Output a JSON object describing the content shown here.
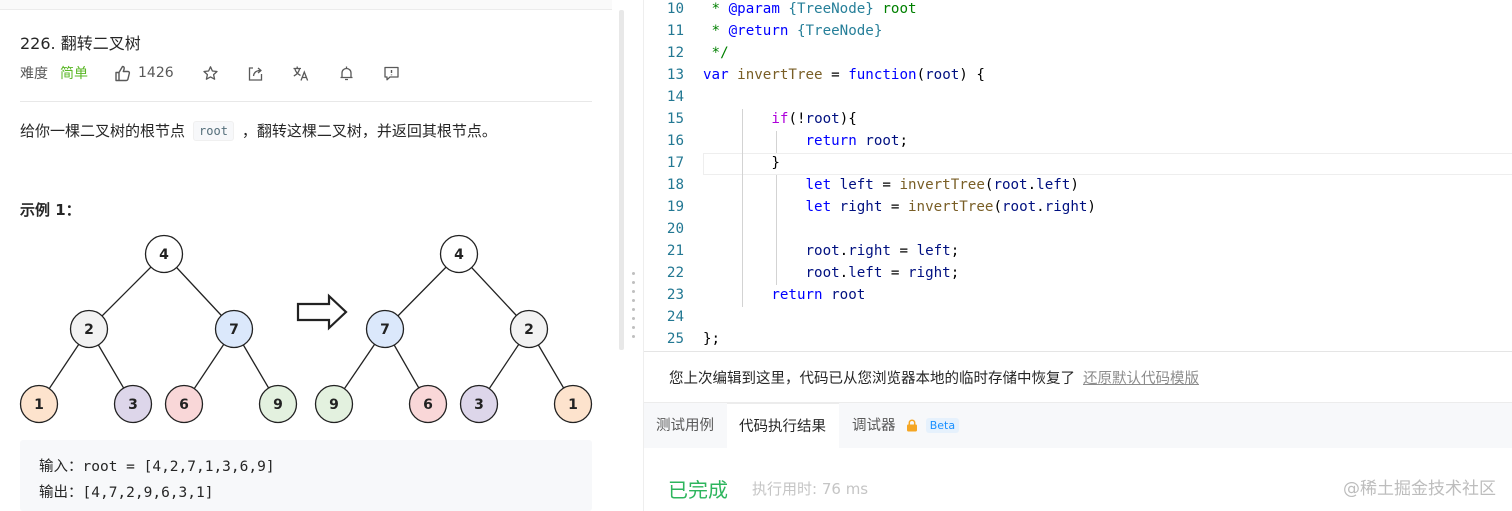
{
  "problem": {
    "title": "226. 翻转二叉树",
    "difficulty_label": "难度",
    "difficulty": "简单",
    "likes": "1426",
    "desc_before": "给你一棵二叉树的根节点",
    "desc_code": "root",
    "desc_after": "，翻转这棵二叉树，并返回其根节点。",
    "example_title": "示例 1：",
    "tree_input": [
      "4",
      "2",
      "7",
      "1",
      "3",
      "6",
      "9"
    ],
    "tree_output": [
      "4",
      "7",
      "2",
      "9",
      "6",
      "3",
      "1"
    ],
    "io": {
      "input": "输入：root = [4,2,7,1,3,6,9]",
      "output": "输出：[4,7,2,9,6,3,1]"
    }
  },
  "icons": [
    "thumbs-up-icon",
    "star-icon",
    "share-icon",
    "translate-icon",
    "bell-icon",
    "feedback-icon",
    "arrow-right-icon",
    "lock-icon"
  ],
  "colors": {
    "easy": "#5ab726",
    "success": "#2db55d",
    "node_blue": "#dbe8fb",
    "node_orange": "#fde3cd",
    "node_purple": "#ddd6ea",
    "node_red": "#f9d7d8",
    "node_green": "#e3f1df",
    "node_gray": "#f2f2f2"
  },
  "editor": {
    "lines": [
      {
        "num": "10",
        "text": " * @param {TreeNode} root"
      },
      {
        "num": "11",
        "text": " * @return {TreeNode}"
      },
      {
        "num": "12",
        "text": " */"
      },
      {
        "num": "13",
        "text": "var invertTree = function(root) {"
      },
      {
        "num": "14",
        "text": ""
      },
      {
        "num": "15",
        "text": "        if(!root){"
      },
      {
        "num": "16",
        "text": "            return root;"
      },
      {
        "num": "17",
        "text": "        }"
      },
      {
        "num": "18",
        "text": "            let left = invertTree(root.left)"
      },
      {
        "num": "19",
        "text": "            let right = invertTree(root.right)"
      },
      {
        "num": "20",
        "text": ""
      },
      {
        "num": "21",
        "text": "            root.right = left;"
      },
      {
        "num": "22",
        "text": "            root.left = right;"
      },
      {
        "num": "23",
        "text": "        return root"
      },
      {
        "num": "24",
        "text": ""
      },
      {
        "num": "25",
        "text": "};"
      }
    ]
  },
  "notice": {
    "text": "您上次编辑到这里，代码已从您浏览器本地的临时存储中恢复了",
    "restore_link": "还原默认代码模版"
  },
  "result_panel": {
    "tabs": [
      "测试用例",
      "代码执行结果",
      "调试器"
    ],
    "active_tab": "代码执行结果",
    "beta_badge": "Beta",
    "status": "已完成",
    "runtime_label": "执行用时:",
    "runtime_value": "76 ms",
    "watermark": "@稀土掘金技术社区"
  }
}
